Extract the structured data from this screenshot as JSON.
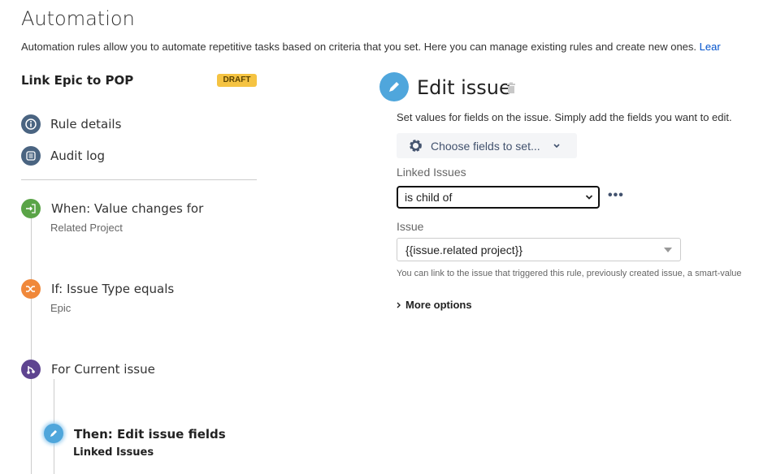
{
  "page": {
    "title": "Automation",
    "description": "Automation rules allow you to automate repetitive tasks based on criteria that you set. Here you can manage existing rules and create new ones.",
    "learn_link": "Lear"
  },
  "rule": {
    "name": "Link Epic to POP",
    "status": "DRAFT"
  },
  "sidebar": {
    "nav": [
      {
        "label": "Rule details",
        "icon": "info-icon"
      },
      {
        "label": "Audit log",
        "icon": "list-icon"
      }
    ],
    "steps": [
      {
        "title": "When: Value changes for",
        "subtitle": "Related Project",
        "icon": "trigger-icon",
        "color": "#5aa447"
      },
      {
        "title": "If: Issue Type equals",
        "subtitle": "Epic",
        "icon": "shuffle-icon",
        "color": "#f0883a"
      },
      {
        "title": "For Current issue",
        "icon": "branch-icon",
        "color": "#5e4490"
      },
      {
        "title": "Then: Edit issue fields",
        "subtitle": "Linked Issues",
        "icon": "pencil-icon",
        "color": "#4fa6db"
      }
    ]
  },
  "editor": {
    "title": "Edit issue",
    "description": "Set values for fields on the issue. Simply add the fields you want to edit.",
    "choose_fields": "Choose fields to set...",
    "linked_issues_label": "Linked Issues",
    "linked_issues_value": "is child of",
    "issue_label": "Issue",
    "issue_value": "{{issue.related project}}",
    "help": "You can link to the issue that triggered this rule, previously created issue, a smart-value",
    "more_options": "More options"
  }
}
